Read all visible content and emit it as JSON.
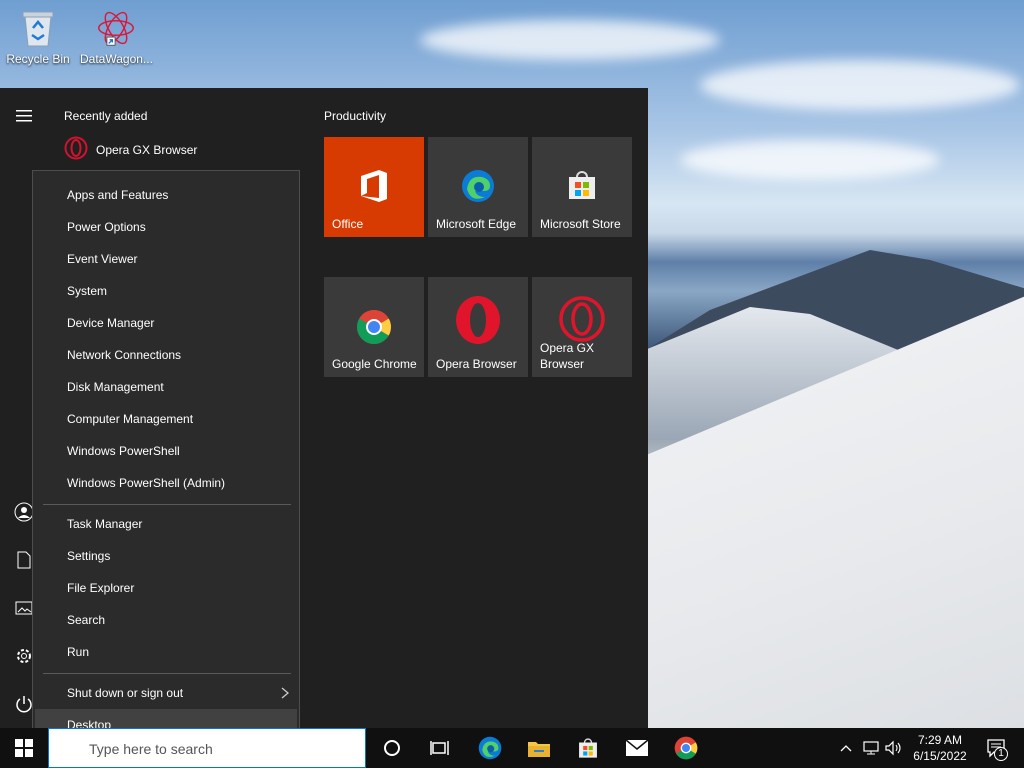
{
  "desktop": {
    "icons": [
      {
        "label": "Recycle Bin",
        "icon": "recycle-bin-icon"
      },
      {
        "label": "DataWagon...",
        "icon": "datawagon-icon"
      }
    ]
  },
  "start_menu": {
    "recently_added_title": "Recently added",
    "recent_apps": [
      {
        "label": "Opera GX Browser",
        "icon": "opera-gx-icon"
      }
    ],
    "group_title": "Productivity",
    "tiles": [
      {
        "label": "Office",
        "icon": "office-icon",
        "color": "#d83b01"
      },
      {
        "label": "Microsoft Edge",
        "icon": "edge-icon"
      },
      {
        "label": "Microsoft Store",
        "icon": "store-icon"
      },
      {
        "label": "Google Chrome",
        "icon": "chrome-icon"
      },
      {
        "label": "Opera Browser",
        "icon": "opera-icon"
      },
      {
        "label": "Opera GX Browser",
        "label_lines": [
          "Opera GX",
          "Browser"
        ],
        "icon": "opera-gx-icon"
      }
    ],
    "rail_icons": [
      "hamburger-icon",
      "user-icon",
      "documents-icon",
      "pictures-icon",
      "settings-icon",
      "power-icon"
    ]
  },
  "context_menu": {
    "group1": [
      "Apps and Features",
      "Power Options",
      "Event Viewer",
      "System",
      "Device Manager",
      "Network Connections",
      "Disk Management",
      "Computer Management",
      "Windows PowerShell",
      "Windows PowerShell (Admin)"
    ],
    "group2": [
      "Task Manager",
      "Settings",
      "File Explorer",
      "Search",
      "Run"
    ],
    "group3": [
      "Shut down or sign out",
      "Desktop"
    ],
    "highlighted": "Desktop"
  },
  "taskbar": {
    "search_placeholder": "Type here to search",
    "pinned": [
      "cortana-icon",
      "task-view-icon",
      "edge-icon",
      "file-explorer-icon",
      "store-icon",
      "mail-icon",
      "chrome-icon"
    ],
    "time": "7:29 AM",
    "date": "6/15/2022",
    "notification_count": "1"
  },
  "colors": {
    "start_bg": "#202020",
    "tile_bg": "#3a3a3a",
    "office": "#d83b01",
    "accent": "#0078d7"
  }
}
